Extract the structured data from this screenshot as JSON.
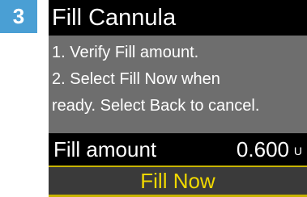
{
  "step_badge": "3",
  "screen": {
    "title": "Fill Cannula",
    "instructions": [
      "1. Verify Fill amount.",
      "2. Select Fill Now when",
      "ready. Select Back to cancel."
    ],
    "fill_amount": {
      "label": "Fill amount",
      "value": "0.600",
      "unit": "U"
    },
    "action_label": "Fill Now"
  },
  "colors": {
    "badge_bg": "#4a9fd4",
    "title_bg": "#000000",
    "body_bg": "#6e6e6e",
    "action_text": "#f0d800",
    "highlight_border": "#c8b400"
  }
}
